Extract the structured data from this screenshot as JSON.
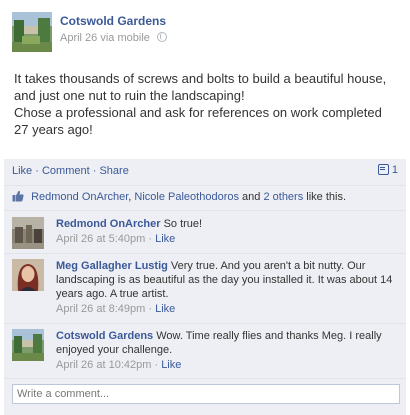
{
  "post": {
    "page_name": "Cotswold Gardens",
    "date": "April 26",
    "via": "via mobile",
    "message_line1": "It takes thousands of screws and bolts to build a beautiful house, and just one nut to ruin the landscaping!",
    "message_line2": "Chose a professional and ask for references on work completed 27 years ago!"
  },
  "actions": {
    "like": "Like",
    "comment": "Comment",
    "share": "Share",
    "separator": "·",
    "comment_count": "1"
  },
  "likes": {
    "name1": "Redmond OnArcher",
    "sep1": ",",
    "name2": "Nicole Paleothodoros",
    "and": "and",
    "others": "2 others",
    "suffix": "like this."
  },
  "comments": [
    {
      "author": "Redmond OnArcher",
      "text": "So true!",
      "time": "April 26 at 5:40pm",
      "like": "Like"
    },
    {
      "author": "Meg Gallagher Lustig",
      "text": "Very true. And you aren't a bit nutty. Our landscaping is as beautiful as the day you installed it. It was about 14 years ago. A true artist.",
      "time": "April 26 at 8:49pm",
      "like": "Like"
    },
    {
      "author": "Cotswold Gardens",
      "text": "Wow. Time really flies and thanks Meg. I really enjoyed your challenge.",
      "time": "April 26 at 10:42pm",
      "like": "Like"
    }
  ],
  "composer": {
    "placeholder": "Write a comment..."
  },
  "colors": {
    "link": "#3b5998",
    "feedback_bg": "#edeff4",
    "meta": "#999999"
  }
}
